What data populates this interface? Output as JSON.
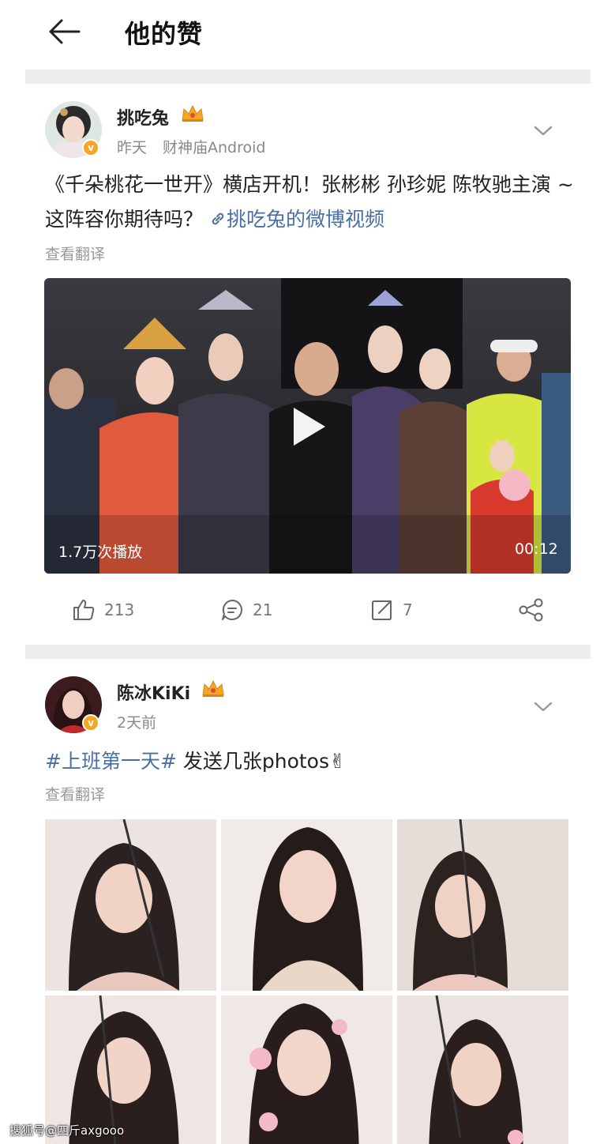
{
  "header": {
    "title": "他的赞",
    "back_icon": "arrow-left-icon"
  },
  "posts": [
    {
      "username": "挑吃兔",
      "time": "昨天",
      "source": "财神庙Android",
      "text_main": "《千朵桃花一世开》横店开机！张彬彬 孙珍妮 陈牧驰主演 ~ 这阵容你期待吗？",
      "link_text": "挑吃兔的微博视频",
      "translate": "查看翻译",
      "video": {
        "views": "1.7万次播放",
        "duration": "00:12"
      },
      "actions": {
        "likes": "213",
        "comments": "21",
        "reposts": "7"
      }
    },
    {
      "username": "陈冰KiKi",
      "time": "2天前",
      "hashtag": "#上班第一天#",
      "text_rest": " 发送几张photos✌",
      "translate": "查看翻译",
      "photo_count": "6"
    }
  ],
  "watermark": "搜狐号@四斤axgooo",
  "colors": {
    "link": "#4a6fa5",
    "meta": "#888888",
    "divider": "#ededed",
    "badge": "#f5a623"
  }
}
